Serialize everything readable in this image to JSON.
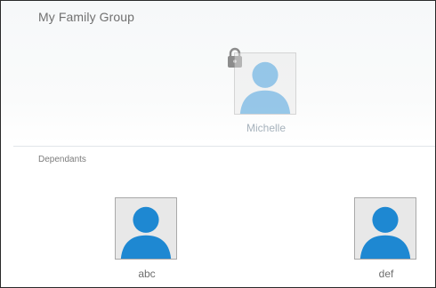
{
  "group": {
    "title": "My Family Group",
    "primary_member": {
      "name": "Michelle",
      "avatar_icon": "user-avatar-icon",
      "status_icon": "lock-icon"
    }
  },
  "dependants": {
    "label": "Dependants",
    "items": [
      {
        "name": "abc",
        "avatar_icon": "user-avatar-icon"
      },
      {
        "name": "def",
        "avatar_icon": "user-avatar-icon"
      }
    ]
  },
  "colors": {
    "avatar_blue": "#1e88d2",
    "avatar_bg": "#e8e8e8",
    "primary_name": "#a6b2bc",
    "lock": "#8c8c8c"
  }
}
